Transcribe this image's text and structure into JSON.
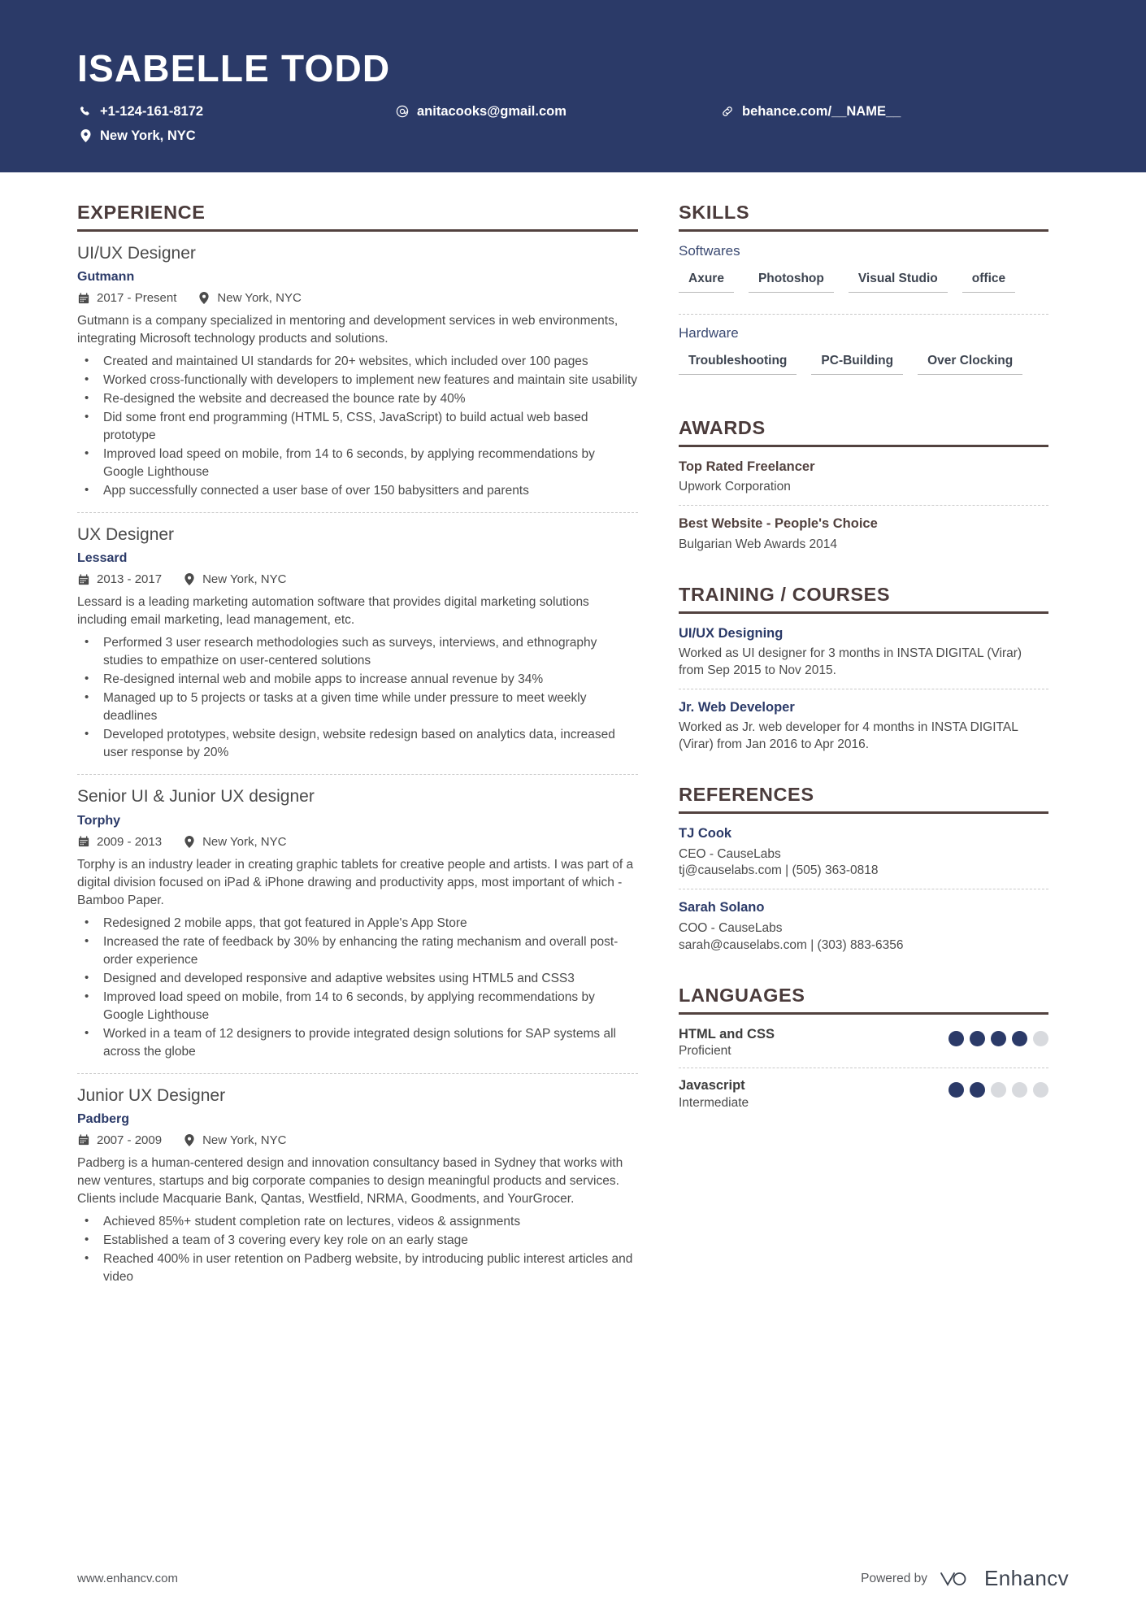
{
  "header": {
    "name": "ISABELLE TODD",
    "contacts": [
      {
        "icon": "phone-icon",
        "text": "+1-124-161-8172"
      },
      {
        "icon": "email-icon",
        "text": "anitacooks@gmail.com"
      },
      {
        "icon": "link-icon",
        "text": "behance.com/__NAME__"
      },
      {
        "icon": "location-icon",
        "text": "New York, NYC"
      }
    ]
  },
  "experience": {
    "title": "EXPERIENCE",
    "jobs": [
      {
        "role": "UI/UX Designer",
        "company": "Gutmann",
        "dates": "2017 - Present",
        "location": "New York, NYC",
        "description": "Gutmann is a company specialized in mentoring and development services in web environments, integrating Microsoft technology products        and solutions.",
        "bullets": [
          "Created and maintained UI standards for 20+ websites, which included over 100 pages",
          "Worked cross-functionally with developers to implement new features and maintain site usability",
          "Re-designed the website and decreased the bounce rate by 40%",
          "Did some front end programming (HTML 5, CSS, JavaScript) to build actual web based prototype",
          "Improved load speed on mobile, from 14 to 6 seconds, by applying recommendations by Google Lighthouse",
          "App successfully connected a user base of over 150 babysitters and parents"
        ]
      },
      {
        "role": "UX Designer",
        "company": "Lessard",
        "dates": "2013 - 2017",
        "location": "New York, NYC",
        "description": "Lessard is a leading marketing automation software that provides digital marketing solutions including email marketing, lead management, etc.",
        "bullets": [
          "Performed 3 user research methodologies such as surveys, interviews, and ethnography studies to empathize on user-centered solutions",
          "Re-designed internal web and mobile apps to increase annual revenue by 34%",
          "Managed up to 5 projects or tasks at a given time while under pressure to meet weekly deadlines",
          "Developed prototypes, website design, website redesign based on analytics data, increased user response by 20%"
        ]
      },
      {
        "role": "Senior UI & Junior UX designer",
        "company": "Torphy",
        "dates": "2009 - 2013",
        "location": "New York, NYC",
        "description": "Torphy is an industry leader in creating graphic tablets for creative people and artists. I was part of a digital division focused on iPad & iPhone drawing and productivity apps, most important of which - Bamboo Paper.",
        "bullets": [
          "Redesigned 2 mobile apps, that got featured in Apple's App Store",
          "Increased the rate of feedback by 30% by enhancing the rating mechanism and overall post-order experience",
          "Designed and developed responsive and adaptive websites using HTML5 and CSS3",
          "Improved load speed on mobile, from 14 to 6 seconds, by applying recommendations by Google Lighthouse",
          "Worked in a team of 12 designers to provide integrated design solutions for SAP systems all across the globe"
        ]
      },
      {
        "role": "Junior UX Designer",
        "company": "Padberg",
        "dates": "2007 - 2009",
        "location": "New York, NYC",
        "description": "Padberg is a human-centered design and innovation consultancy based in Sydney that works with new ventures, startups and big corporate companies to design meaningful products and services. Clients include Macquarie Bank, Qantas, Westfield, NRMA, Goodments, and YourGrocer.",
        "bullets": [
          "Achieved 85%+ student completion rate on lectures, videos & assignments",
          "Established a team of 3 covering every key role on an early stage",
          "Reached 400% in user retention on Padberg website, by introducing public interest articles and video"
        ]
      }
    ]
  },
  "skills": {
    "title": "SKILLS",
    "groups": [
      {
        "name": "Softwares",
        "tags": [
          "Axure",
          "Photoshop",
          "Visual Studio",
          "office"
        ]
      },
      {
        "name": "Hardware",
        "tags": [
          "Troubleshooting",
          "PC-Building",
          "Over Clocking"
        ]
      }
    ]
  },
  "awards": {
    "title": "AWARDS",
    "items": [
      {
        "title": "Top Rated Freelancer",
        "sub": "Upwork Corporation"
      },
      {
        "title": "Best Website - People's Choice",
        "sub": "Bulgarian Web Awards 2014"
      }
    ]
  },
  "training": {
    "title": "TRAINING / COURSES",
    "items": [
      {
        "title": "UI/UX Designing",
        "sub": "Worked as UI designer for 3 months in INSTA DIGITAL (Virar) from Sep 2015 to Nov 2015."
      },
      {
        "title": "Jr. Web Developer",
        "sub": "Worked as Jr. web developer for 4 months in INSTA DIGITAL (Virar) from Jan 2016 to Apr 2016."
      }
    ]
  },
  "references": {
    "title": "REFERENCES",
    "items": [
      {
        "title": "TJ Cook",
        "sub": "CEO - CauseLabs\ntj@causelabs.com | (505) 363-0818"
      },
      {
        "title": "Sarah Solano",
        "sub": "COO - CauseLabs\nsarah@causelabs.com | (303) 883-6356"
      }
    ]
  },
  "languages": {
    "title": "LANGUAGES",
    "items": [
      {
        "name": "HTML and CSS",
        "level": "Proficient",
        "filled": 4,
        "total": 5
      },
      {
        "name": "Javascript",
        "level": "Intermediate",
        "filled": 2,
        "total": 5
      }
    ]
  },
  "footer": {
    "url": "www.enhancv.com",
    "powered_by": "Powered by",
    "brand": "Enhancv"
  },
  "colors": {
    "header_bg": "#2b3a68",
    "accent_brown": "#52423f",
    "accent_navy": "#2b3a68"
  }
}
